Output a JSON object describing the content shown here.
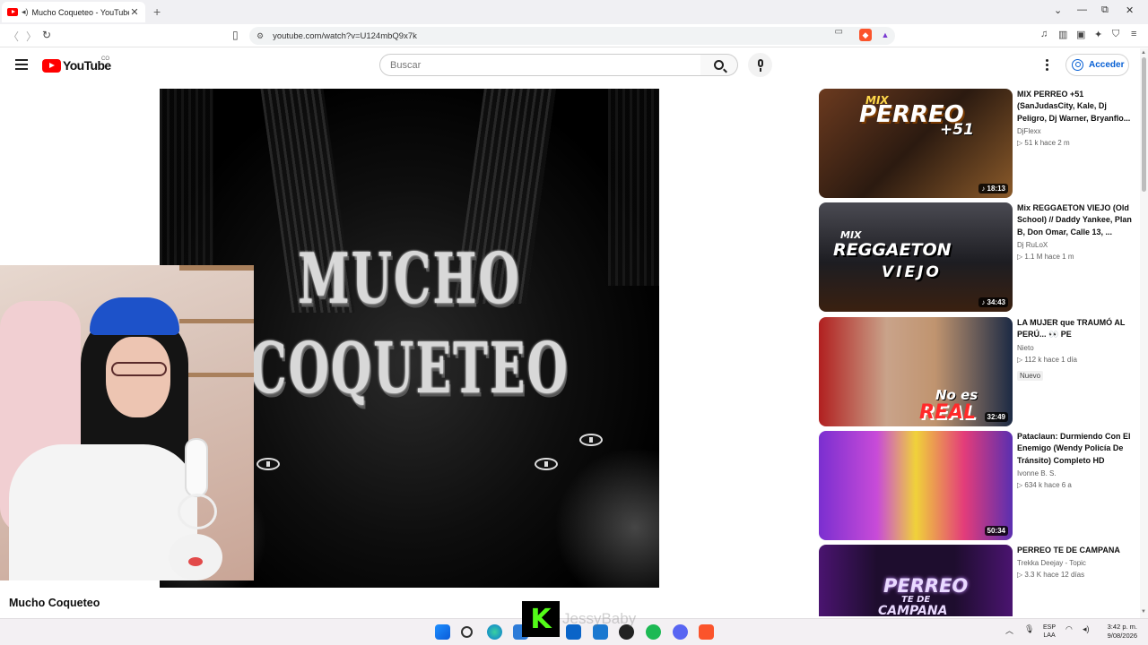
{
  "browser": {
    "tab_title": "Mucho Coqueteo - YouTube",
    "tab_close": "✕",
    "new_tab": "+",
    "url": "youtube.com/watch?v=U124mbQ9x7k",
    "window_controls": [
      "⌄",
      "—",
      "⧉",
      "✕"
    ]
  },
  "youtube": {
    "logo_text": "YouTube",
    "country_code": "CO",
    "search_placeholder": "Buscar",
    "sign_in_label": "Acceder"
  },
  "player": {
    "art_title_line1": "MUCHO",
    "art_title_line2": "COQUETEO"
  },
  "video": {
    "title": "Mucho Coqueteo"
  },
  "recommendations": [
    {
      "title": "MIX PERREO +51 (SanJudasCity, Kale, Dj Peligro, Dj Warner, Bryanflo...",
      "channel": "DjFlexx",
      "stats": "▷  51 k   hace 2 m",
      "duration": "♪ 18:13",
      "thumb_text_1": "MIX",
      "thumb_text_2": "PERREO",
      "thumb_text_3": "+51"
    },
    {
      "title": "Mix REGGAETON VIEJO (Old School) // Daddy Yankee, Plan B, Don Omar, Calle 13, ...",
      "channel": "Dj RuLoX",
      "stats": "▷  1.1 M   hace 1 m",
      "duration": "♪ 34:43",
      "thumb_text_1": "MIX",
      "thumb_text_2": "REGGAETON",
      "thumb_text_3": "VIEJO"
    },
    {
      "title": "LA MUJER que TRAUMÓ AL PERÚ... 👀 PE",
      "channel": "Nieto",
      "stats": "▷  112 k   hace 1 día",
      "badge": "Nuevo",
      "duration": "32:49",
      "thumb_text_1": "No es",
      "thumb_text_2": "REAL"
    },
    {
      "title": "Pataclaun: Durmiendo Con El Enemigo (Wendy Policía De Tránsito) Completo HD",
      "channel": "Ivonne B. S.",
      "stats": "▷  634 k   hace 6 a",
      "duration": "50:34"
    },
    {
      "title": "PERREO TE DE CAMPANA",
      "channel": "Trekka Deejay - Topic",
      "stats": "▷  3.3 K   hace 12 días",
      "thumb_text_1": "PERREO",
      "thumb_text_2": "TE DE",
      "thumb_text_3": "CAMPANA"
    }
  ],
  "overlay": {
    "kick_letter": "K",
    "watermark": "JessyBaby"
  },
  "taskbar": {
    "lang_1": "ESP",
    "lang_2": "LAA",
    "time": "3:42 p. m.",
    "date": "9/08/2026"
  },
  "colors": {
    "youtube_red": "#ff0000",
    "link_blue": "#065fd4",
    "kick_green": "#53fc18"
  }
}
